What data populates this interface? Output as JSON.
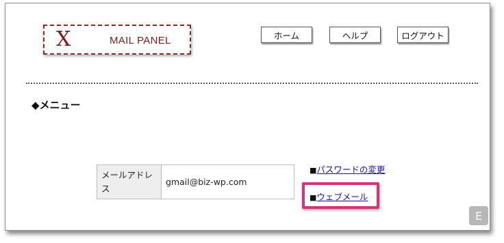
{
  "logo": {
    "mark": "X",
    "text": "MAIL PANEL"
  },
  "nav": {
    "home_label": "ホーム",
    "help_label": "ヘルプ",
    "logout_label": "ログアウト"
  },
  "menu": {
    "title": "◆メニュー"
  },
  "account": {
    "email_label": "メールアドレス",
    "email_value": "gmail@biz-wp.com"
  },
  "links": {
    "bullet": "■",
    "change_password": "パスワードの変更",
    "webmail": "ウェブメール"
  },
  "badge": {
    "letter": "E"
  },
  "colors": {
    "logo": "#7a1a1a",
    "link": "#1a0dab",
    "highlight": "#d6337a"
  }
}
